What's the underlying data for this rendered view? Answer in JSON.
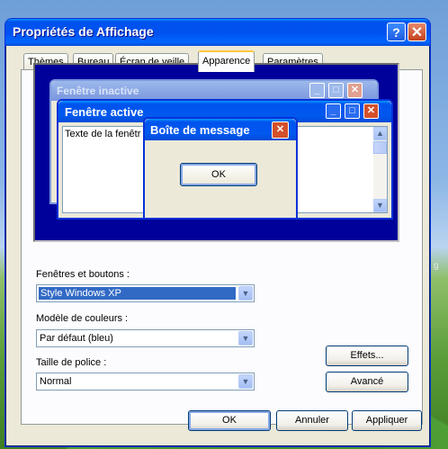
{
  "window": {
    "title": "Propriétés de Affichage",
    "help_glyph": "?",
    "close_glyph": "✕"
  },
  "tabs": [
    {
      "label": "Thèmes"
    },
    {
      "label": "Bureau"
    },
    {
      "label": "Écran de veille"
    },
    {
      "label": "Apparence",
      "active": true
    },
    {
      "label": "Paramètres"
    }
  ],
  "preview": {
    "inactive_title": "Fenêtre inactive",
    "active_title": "Fenêtre active",
    "window_text": "Texte de la fenêtr",
    "message_title": "Boîte de message",
    "message_ok": "OK"
  },
  "fields": {
    "windows_buttons_label": "Fenêtres et boutons :",
    "windows_buttons_value": "Style Windows XP",
    "color_scheme_label": "Modèle de couleurs :",
    "color_scheme_value": "Par défaut (bleu)",
    "font_size_label": "Taille de police :",
    "font_size_value": "Normal"
  },
  "buttons": {
    "effects": "Effets...",
    "advanced": "Avancé",
    "ok": "OK",
    "cancel": "Annuler",
    "apply": "Appliquer"
  },
  "desktop": {
    "edge_text": "g"
  },
  "colors": {
    "title_blue": "#0058ee",
    "preview_bg": "#00009a",
    "selection": "#316ac5"
  }
}
